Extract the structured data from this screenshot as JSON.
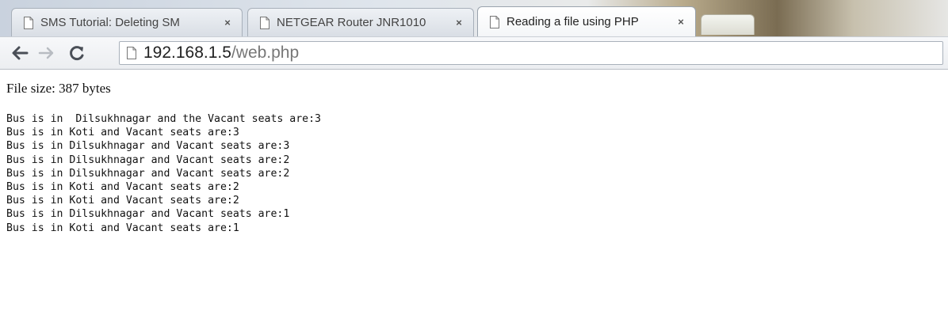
{
  "tabs": [
    {
      "title": "SMS Tutorial: Deleting SM",
      "close": "×",
      "active": false
    },
    {
      "title": "NETGEAR Router JNR1010",
      "close": "×",
      "active": false
    },
    {
      "title": "Reading a file using PHP",
      "close": "×",
      "active": true
    }
  ],
  "toolbar": {
    "back_icon": "←",
    "forward_icon": "→",
    "reload_icon": "C"
  },
  "address": {
    "host": "192.168.1.5",
    "path": "/web.php"
  },
  "page": {
    "file_size": "File size: 387 bytes",
    "lines": [
      "Bus is in  Dilsukhnagar and the Vacant seats are:3",
      "Bus is in Koti and Vacant seats are:3",
      "Bus is in Dilsukhnagar and Vacant seats are:3",
      "Bus is in Dilsukhnagar and Vacant seats are:2",
      "Bus is in Dilsukhnagar and Vacant seats are:2",
      "Bus is in Koti and Vacant seats are:2",
      "Bus is in Koti and Vacant seats are:2",
      "Bus is in Dilsukhnagar and Vacant seats are:1",
      "Bus is in Koti and Vacant seats are:1"
    ]
  },
  "colors": {
    "active_tab": "#ffffff",
    "toolbar": "#eceef1",
    "url_path": "#777777"
  }
}
